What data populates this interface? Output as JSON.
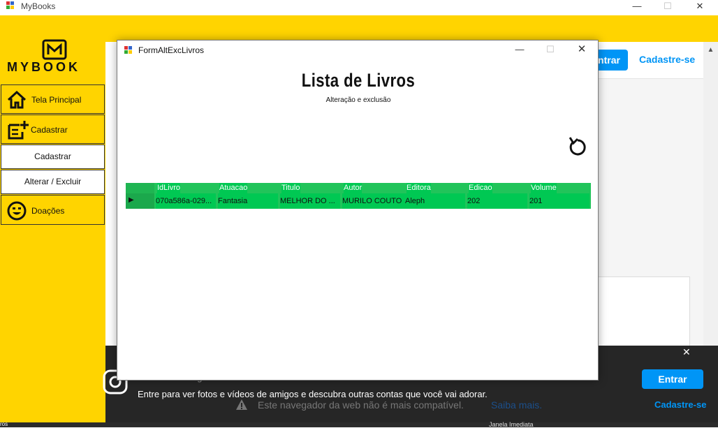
{
  "window": {
    "title": "MyBooks",
    "controls": {
      "minimize": "—",
      "maximize": "☐",
      "close": "✕"
    }
  },
  "sidebar": {
    "logo_text": "MYBOOK",
    "items": [
      {
        "label": "Tela Principal",
        "icon": "home-icon"
      },
      {
        "label": "Cadastrar",
        "icon": "add-note-icon"
      },
      {
        "label": "Cadastrar",
        "icon": ""
      },
      {
        "label": "Alterar / Excluir",
        "icon": ""
      },
      {
        "label": "Doações",
        "icon": "smile-icon"
      }
    ]
  },
  "browser": {
    "entrar_top": "ntrar",
    "cadastre_top": "Cadastre-se",
    "banner": {
      "line1": "Entrar no Instagram",
      "line2": "Entre para ver fotos e vídeos de amigos e descubra outras contas que você vai adorar.",
      "warning": "Este navegador da web não é mais compatível.",
      "saiba": "Saiba mais.",
      "entrar": "Entrar",
      "cadastre": "Cadastre-se",
      "close": "✕"
    },
    "bottom_left": "ros",
    "bottom_right": "Janela Imediata"
  },
  "dialog": {
    "title": "FormAltExcLivros",
    "controls": {
      "minimize": "—",
      "maximize": "☐",
      "close": "✕"
    },
    "heading": "Lista de Livros",
    "subheading": "Alteração e exclusão",
    "grid": {
      "columns": [
        "IdLivro",
        "Atuacao",
        "Titulo",
        "Autor",
        "Editora",
        "Edicao",
        "Volume"
      ],
      "rows": [
        [
          "070a586a-029...",
          "Fantasia",
          "MELHOR DO ...",
          "MURILO COUTO",
          "Aleph",
          "202",
          "201"
        ]
      ]
    }
  },
  "colors": {
    "yellow": "#ffd400",
    "green": "#00c853",
    "instagram_blue": "#0095f6"
  }
}
